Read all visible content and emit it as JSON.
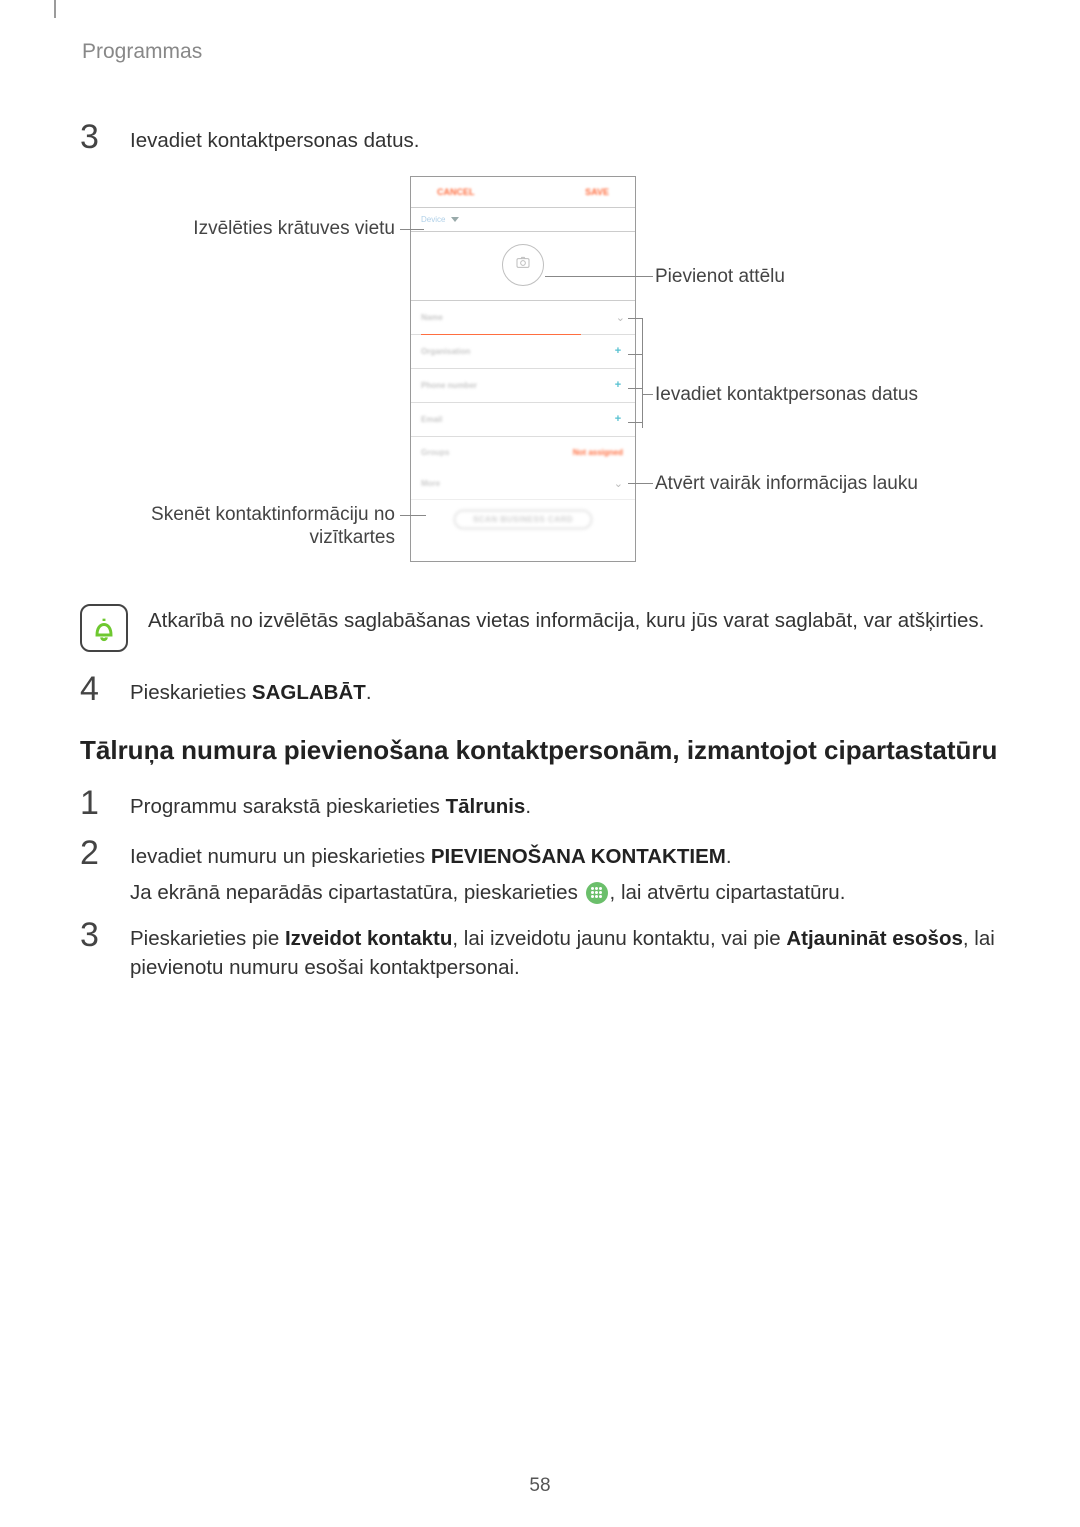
{
  "header": "Programmas",
  "step3_num": "3",
  "step3_text": "Ievadiet kontaktpersonas datus.",
  "callouts": {
    "storage": "Izvēlēties krātuves vietu",
    "scan_line1": "Skenēt kontaktinformāciju no",
    "scan_line2": "vizītkartes",
    "add_image": "Pievienot attēlu",
    "enter_data": "Ievadiet kontaktpersonas datus",
    "more_fields": "Atvērt vairāk informācijas lauku"
  },
  "phone": {
    "cancel": "CANCEL",
    "save": "SAVE",
    "storage": "Device",
    "name": "Name",
    "organisation": "Organisation",
    "phone": "Phone number",
    "email": "Email",
    "groups": "Groups",
    "group_val": "Not assigned",
    "more": "More",
    "scan": "SCAN BUSINESS CARD"
  },
  "note_text": "Atkarībā no izvēlētās saglabāšanas vietas informācija, kuru jūs varat saglabāt, var atšķirties.",
  "step4_num": "4",
  "step4_pre": "Pieskarieties ",
  "step4_bold": "SAGLABĀT",
  "section_heading": "Tālruņa numura pievienošana kontaktpersonām, izmantojot cipartastatūru",
  "b_step1_num": "1",
  "b_step1_pre": "Programmu sarakstā pieskarieties ",
  "b_step1_bold": "Tālrunis",
  "b_step2_num": "2",
  "b_step2_l1_pre": "Ievadiet numuru un pieskarieties ",
  "b_step2_l1_bold": "PIEVIENOŠANA KONTAKTIEM",
  "b_step2_l2_pre": "Ja ekrānā neparādās cipartastatūra, pieskarieties ",
  "b_step2_l2_post": ", lai atvērtu cipartastatūru.",
  "b_step3_num": "3",
  "b_step3_pre": "Pieskarieties pie ",
  "b_step3_b1": "Izveidot kontaktu",
  "b_step3_mid": ", lai izveidotu jaunu kontaktu, vai pie ",
  "b_step3_b2": "Atjaunināt esošos",
  "b_step3_post": ", lai pievienotu numuru esošai kontaktpersonai.",
  "page_number": "58"
}
